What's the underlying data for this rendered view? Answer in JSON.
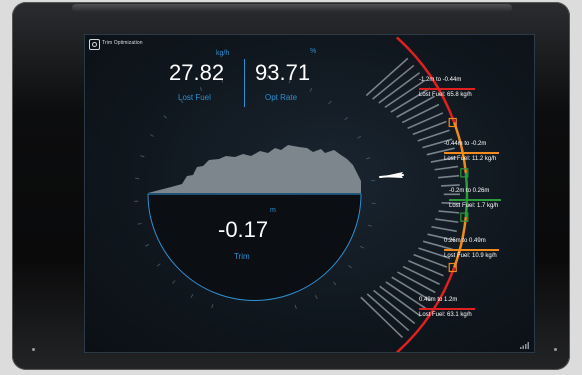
{
  "app": {
    "title": "Trim Optimization",
    "icon": "settings-gear-icon"
  },
  "kpis": {
    "lost_fuel": {
      "value": "27.82",
      "unit": "kg/h",
      "label": "Lost Fuel"
    },
    "opt_rate": {
      "value": "93.71",
      "unit": "%",
      "label": "Opt Rate"
    }
  },
  "trim": {
    "value": "-0.17",
    "unit": "m",
    "label": "Trim"
  },
  "zones": [
    {
      "range": "-1.2m to -0.44m",
      "loss": "Lost Fuel: 65.8 kg/h",
      "color": "#e02020"
    },
    {
      "range": "-0.44m to -0.2m",
      "loss": "Lost Fuel: 11.2 kg/h",
      "color": "#f08a1c"
    },
    {
      "range": "-0.2m to 0.26m",
      "loss": "Lost Fuel: 1.7 kg/h",
      "color": "#2a9a3a"
    },
    {
      "range": "0.26m to 0.49m",
      "loss": "Lost Fuel: 10.9 kg/h",
      "color": "#f08a1c"
    },
    {
      "range": "0.49m to 1.2m",
      "loss": "Lost Fuel: 63.1 kg/h",
      "color": "#e02020"
    }
  ],
  "colors": {
    "accent": "#2f8fd0",
    "background": "#0f161d",
    "ship": "#7d868d",
    "bars": "#8a949c"
  }
}
